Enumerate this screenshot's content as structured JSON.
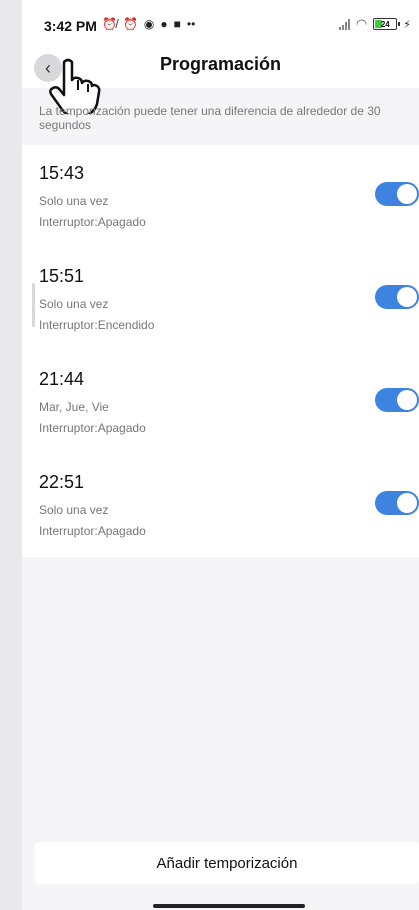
{
  "status_bar": {
    "time": "3:42 PM",
    "battery": "24",
    "icons_left": [
      "alarm-off-icon",
      "alarm-clock-icon",
      "messenger-icon",
      "spotify-icon",
      "video-icon",
      "more-dots-icon"
    ],
    "icons_right": [
      "signal-icon",
      "wifi-icon",
      "battery-icon",
      "charging-icon"
    ]
  },
  "header": {
    "title": "Programación",
    "back_icon": "back-arrow-icon"
  },
  "notice": "La temporización puede tener una diferencia de alrededor de 30 segundos",
  "timers": [
    {
      "time": "15:43",
      "repeat": "Solo una vez",
      "switch": "Interruptor:Apagado",
      "enabled": true
    },
    {
      "time": "15:51",
      "repeat": "Solo una vez",
      "switch": "Interruptor:Encendido",
      "enabled": true
    },
    {
      "time": "21:44",
      "repeat": "Mar, Jue, Vie",
      "switch": "Interruptor:Apagado",
      "enabled": true
    },
    {
      "time": "22:51",
      "repeat": "Solo una vez",
      "switch": "Interruptor:Apagado",
      "enabled": true
    }
  ],
  "add_button_label": "Añadir temporización",
  "colors": {
    "accent": "#3f83e0",
    "background": "#f5f5f7",
    "card": "#ffffff",
    "secondary_text": "#777777"
  }
}
